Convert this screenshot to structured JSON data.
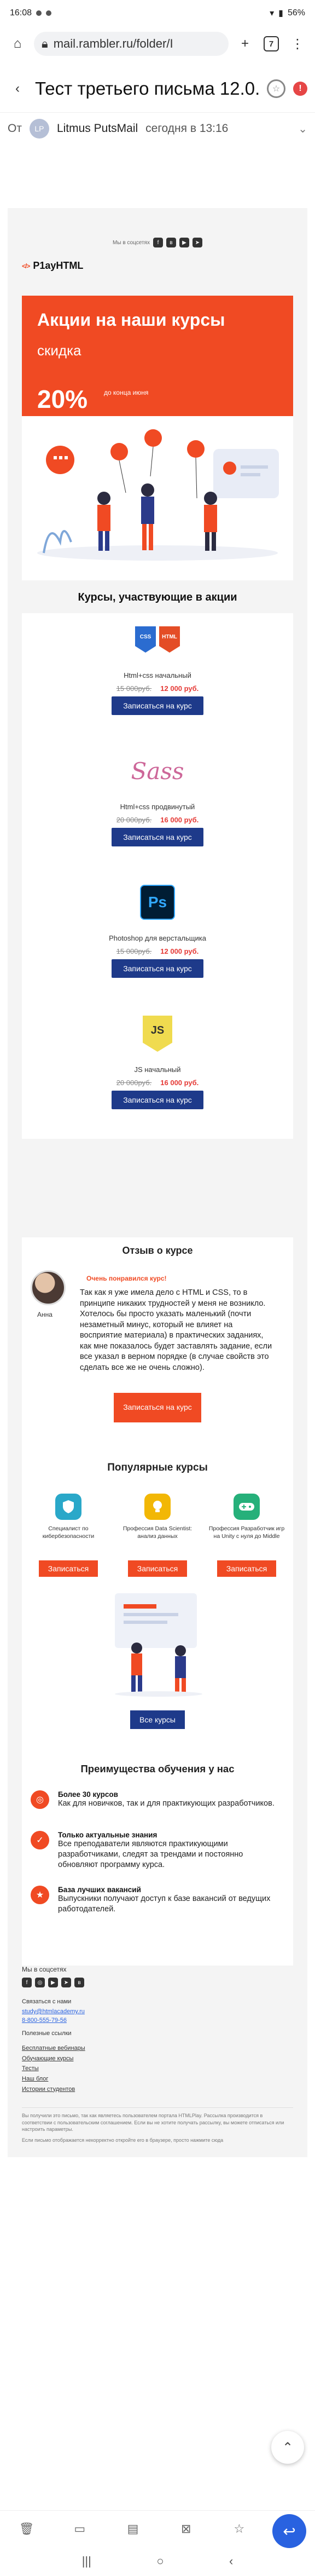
{
  "status_bar": {
    "time": "16:08",
    "battery": "56%"
  },
  "browser": {
    "url": "mail.rambler.ru/folder/I",
    "tab_count": "7"
  },
  "mail": {
    "subject": "Тест третьего письма 12.0.",
    "from_label": "От",
    "sender": "Litmus PutsMail",
    "date": "сегодня в 13:16",
    "avatar_initials": "LP"
  },
  "letter": {
    "mobile_version_text": "Мы в соцсетях",
    "brand": "P1ayHTML",
    "promo": {
      "title": "Акции на наши курсы",
      "subtitle": "",
      "discount_label": "скидка",
      "percent": "20%",
      "till_text": "до конца июня"
    },
    "courses_title": "Курсы, участвующие в акции",
    "courses": [
      {
        "name": "Html+css начальный",
        "old_price": "15 000руб.",
        "new_price": "12 000 руб.",
        "button": "Записаться на курс",
        "icon": "html-css-icon"
      },
      {
        "name": "Html+css продвинутый",
        "old_price": "20 000руб.",
        "new_price": "16 000 руб.",
        "button": "Записаться на курс",
        "icon": "sass-icon"
      },
      {
        "name": "Photoshop для верстальщика",
        "old_price": "15 000руб.",
        "new_price": "12 000 руб.",
        "button": "Записаться на курс",
        "icon": "photoshop-icon"
      },
      {
        "name": "JS начальный",
        "old_price": "20 000руб.",
        "new_price": "16 000 руб.",
        "button": "Записаться на курс",
        "icon": "js-icon"
      }
    ],
    "review": {
      "title": "Отзыв о курсе",
      "liked": "Очень понравился курс!",
      "author": "Анна",
      "text": "Так как я уже имела дело с HTML и CSS, то в принципе никаких трудностей у меня не возникло. Хотелось бы просто указать маленький (почти незаметный минус, который не влияет на восприятие материала) в практических заданиях, как мне показалось будет заставлять задание, если все указал в верном порядке (в случае свойств это сделать все же не очень сложно).",
      "button": "Записаться на курс"
    },
    "popular": {
      "title": "Популярные курсы",
      "items": [
        {
          "name": "Специалист по кибербезопасности",
          "button": "Записаться",
          "icon": "shield-icon",
          "color": "#2aa8c9"
        },
        {
          "name": "Профессия Data Scientist: анализ данных",
          "button": "Записаться",
          "icon": "lightbulb-icon",
          "color": "#f2b705"
        },
        {
          "name": "Профессия Разработчик игр на Unity с нуля до Middle",
          "button": "Записаться",
          "icon": "gamepad-icon",
          "color": "#26b07a"
        }
      ],
      "all_button": "Все курсы"
    },
    "advantages": {
      "title": "Преимущества обучения у нас",
      "items": [
        {
          "heading": "Более 30 курсов",
          "desc": "Как для новичков, так и для практикующих разработчиков."
        },
        {
          "heading": "Только актуальные знания",
          "desc": "Все преподаватели являются практикующими разработчиками, следят за трендами и постоянно обновляют программу курса."
        },
        {
          "heading": "База лучших вакансий",
          "desc": "Выпускники получают доступ к базе вакансий от ведущих работодателей."
        }
      ]
    },
    "footer": {
      "social_title": "Мы в соцсетях",
      "contact_title": "Связаться с нами",
      "email": "study@htmlacademy.ru",
      "phone": "8-800-555-79-56",
      "links_title": "Полезные ссылки",
      "links": [
        "Бесплатные вебинары",
        "Обучающие курсы",
        "Тесты",
        "Наш блог",
        "Истории студентов"
      ],
      "legal_1": "Вы получили это письмо, так как являетесь пользователем портала HTMLPlay. Рассылка производится в соответствии с пользовательским соглашением. Если вы не хотите получать рассылку, вы можете отписаться или настроить параметры.",
      "legal_2": "Если письмо отображается некорректно откройте его в браузере, просто нажмите сюда"
    }
  }
}
